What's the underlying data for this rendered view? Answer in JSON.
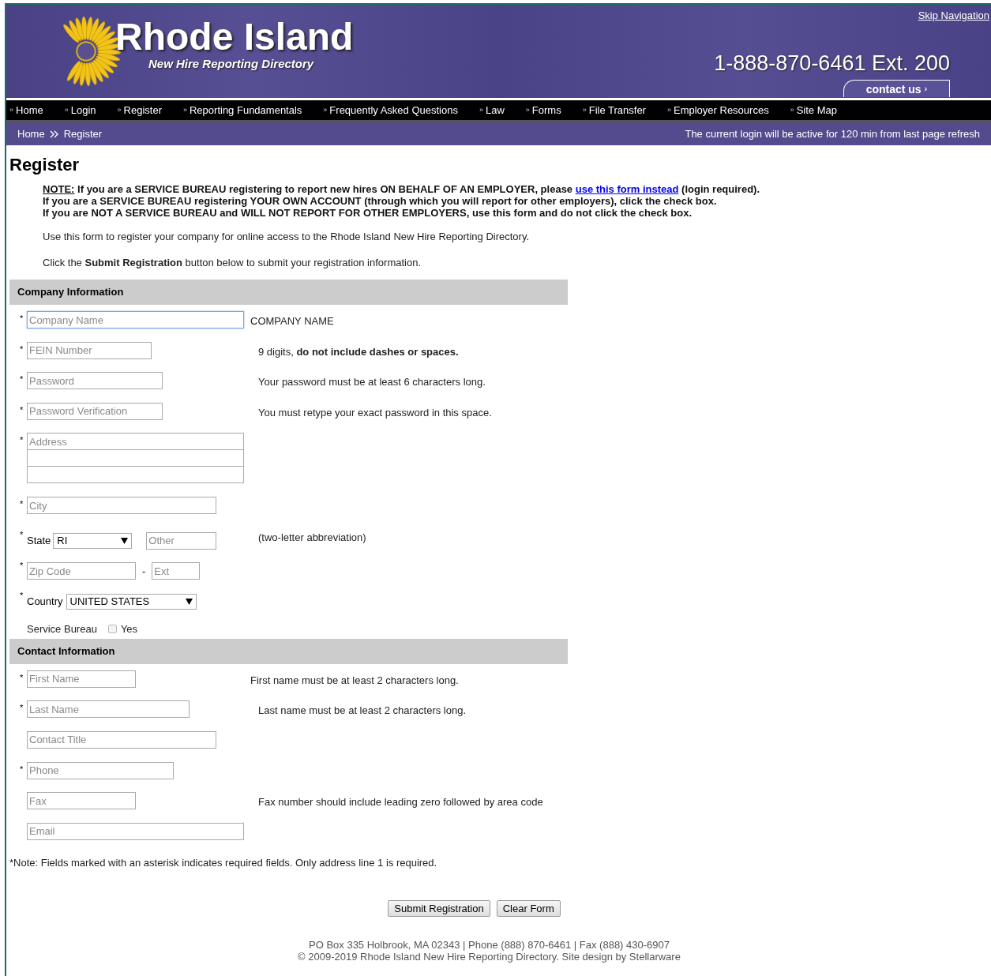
{
  "header": {
    "skip_link": "Skip Navigation",
    "title": "Rhode Island",
    "subtitle": "New Hire Reporting Directory",
    "phone": "1-888-870-6461 Ext. 200",
    "contact_button": "contact us",
    "contact_arrow": "›"
  },
  "nav": [
    {
      "marker": "»",
      "label": "Home"
    },
    {
      "marker": "»",
      "label": "Login"
    },
    {
      "marker": "»",
      "label": "Register"
    },
    {
      "marker": "»",
      "label": "Reporting Fundamentals"
    },
    {
      "marker": "»",
      "label": "Frequently Asked Questions"
    },
    {
      "marker": "»",
      "label": "Law"
    },
    {
      "marker": "»",
      "label": "Forms"
    },
    {
      "marker": "»",
      "label": "File Transfer"
    },
    {
      "marker": "»",
      "label": "Employer Resources"
    },
    {
      "marker": "»",
      "label": "Site Map"
    }
  ],
  "breadcrumb": {
    "items": [
      "Home",
      "Register"
    ],
    "session_notice": "The current login will be active for 120 min from last page refresh"
  },
  "page_title": "Register",
  "note": {
    "label": "NOTE:",
    "line_1_before": "If you are a SERVICE BUREAU registering to report new hires ON BEHALF OF AN EMPLOYER, please",
    "link": "use this form instead",
    "line_1_after": "(login required).",
    "line_2": "If you are a SERVICE BUREAU registering YOUR OWN ACCOUNT (through which you will report for other employers), click the check box.",
    "line_3": "If you are NOT A SERVICE BUREAU and WILL NOT REPORT FOR OTHER EMPLOYERS, use this form and do not click the check box."
  },
  "intro": [
    "Use this form to register your company for online access to the Rhode Island New Hire Reporting Directory.",
    "Click the **Submit Registration** button below to submit your registration information."
  ],
  "sections": [
    {
      "title": "Company Information",
      "fields": [
        {
          "kind": "text",
          "marker": "*",
          "placeholder": "Company Name",
          "focused": true,
          "hint": "COMPANY NAME"
        },
        {
          "kind": "text",
          "marker": "*",
          "placeholder": "FEIN Number",
          "focused": false,
          "hint": "9 digits, **do not include dashes or spaces.**"
        },
        {
          "kind": "text",
          "marker": "*",
          "placeholder": "Password",
          "focused": false,
          "hint": "Your password must be at least 6 characters long."
        },
        {
          "kind": "text",
          "marker": "*",
          "placeholder": "Password Verification",
          "focused": false,
          "hint": "You must retype your exact password in this space."
        },
        {
          "kind": "address",
          "marker": "*",
          "placeholder": "Address",
          "focused": false
        },
        {
          "kind": "text",
          "marker": "*",
          "placeholder": "City",
          "focused": false
        },
        {
          "kind": "state",
          "marker": "*",
          "label": "State",
          "value": "RI",
          "other_placeholder": "Other",
          "focused": false,
          "hint": "(two-letter abbreviation)"
        },
        {
          "kind": "zip",
          "marker": "*",
          "placeholder": "Zip Code",
          "separator": "-",
          "ext_placeholder": "Ext",
          "focused": false
        },
        {
          "kind": "country",
          "marker": "*",
          "label": "Country",
          "value": "UNITED STATES",
          "focused": false
        },
        {
          "kind": "checkbox",
          "label": "Service Bureau",
          "option": "Yes",
          "checked": false,
          "focused": false
        }
      ]
    },
    {
      "title": "Contact Information",
      "fields": [
        {
          "kind": "text",
          "marker": "*",
          "placeholder": "First Name",
          "focused": false,
          "hint": "First name must be at least 2 characters long."
        },
        {
          "kind": "text",
          "marker": "*",
          "placeholder": "Last Name",
          "focused": false,
          "hint": "Last name must be at least 2 characters long."
        },
        {
          "kind": "text",
          "placeholder": "Contact Title",
          "focused": false
        },
        {
          "kind": "text",
          "marker": "*",
          "placeholder": "Phone",
          "focused": false
        },
        {
          "kind": "text",
          "placeholder": "Fax",
          "focused": false,
          "hint": "Fax number should include leading zero followed by area code"
        },
        {
          "kind": "text",
          "placeholder": "Email",
          "focused": false
        }
      ]
    }
  ],
  "required_note": "*Note: Fields marked with an asterisk indicates required fields. Only address line 1 is required.",
  "buttons": [
    "Submit Registration",
    "Clear Form"
  ],
  "footer": [
    "PO Box 335 Holbrook, MA 02343 | Phone (888) 870-6461 | Fax (888) 430-6907",
    "© 2009-2019 Rhode Island New Hire Reporting Directory. Site design by Stellarware"
  ]
}
